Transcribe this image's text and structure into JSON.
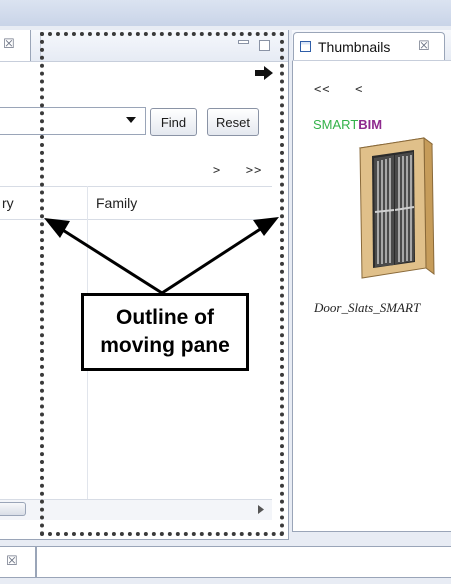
{
  "left_pane": {
    "tab_close_glyph": "☒",
    "find_label": "Find",
    "reset_label": "Reset",
    "nav_forward": ">   >>",
    "columns": [
      "ry",
      "Family"
    ]
  },
  "right_pane": {
    "tab_title": "Thumbnails",
    "tab_close_glyph": "☒",
    "nav_back": "<<   <",
    "brand": {
      "part1": "SMART",
      "part2": "BIM"
    },
    "thumbnail_caption": "Door_Slats_SMART"
  },
  "bottom": {
    "tab_close_glyph": "☒"
  },
  "annotation": {
    "line1": "Outline of",
    "line2": "moving pane"
  },
  "colors": {
    "brand_green": "#33b24a",
    "brand_purple": "#8e2a8e",
    "door_frame": "#e0c08a",
    "door_dark": "#3a3a3a"
  },
  "icons": [
    "close-icon",
    "minimize-icon",
    "maximize-icon",
    "dropdown-arrow-icon",
    "arrow-right-icon",
    "thumbnails-view-icon",
    "door-thumbnail"
  ]
}
